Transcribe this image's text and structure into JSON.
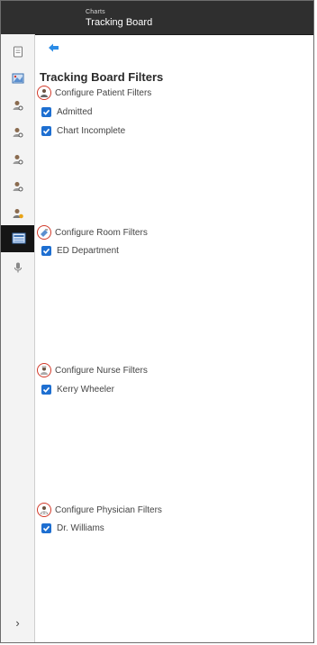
{
  "header": {
    "subtitle": "Charts",
    "title": "Tracking Board"
  },
  "sidebar": {
    "items": [
      {
        "icon": "clipboard-icon"
      },
      {
        "icon": "chart-image-icon"
      },
      {
        "icon": "user-search-icon"
      },
      {
        "icon": "user-search-icon"
      },
      {
        "icon": "user-search-icon"
      },
      {
        "icon": "user-search-icon"
      },
      {
        "icon": "user-alert-icon"
      },
      {
        "icon": "tracking-board-icon",
        "active": true
      },
      {
        "icon": "microphone-icon"
      }
    ],
    "expand_icon": "›"
  },
  "main": {
    "title": "Tracking Board Filters",
    "sections": [
      {
        "label": "Configure Patient Filters",
        "icon": "patient-icon",
        "items": [
          "Admitted",
          "Chart Incomplete"
        ]
      },
      {
        "label": "Configure Room Filters",
        "icon": "room-icon",
        "items": [
          "ED Department"
        ]
      },
      {
        "label": "Configure Nurse Filters",
        "icon": "nurse-icon",
        "items": [
          "Kerry Wheeler"
        ]
      },
      {
        "label": "Configure Physician Filters",
        "icon": "physician-icon",
        "items": [
          "Dr. Williams"
        ]
      }
    ]
  },
  "colors": {
    "accent": "#1e6fd1",
    "icon_ring": "#d23a2a",
    "topbar": "#2f2f2f"
  }
}
